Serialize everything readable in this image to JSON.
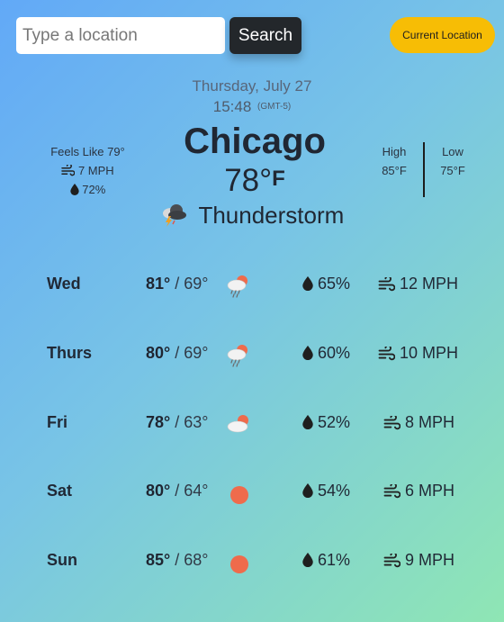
{
  "search": {
    "placeholder": "Type a location",
    "button_label": "Search",
    "current_location_label": "Current Location"
  },
  "current": {
    "date": "Thursday, July 27",
    "time": "15:48",
    "timezone": "(GMT-5)",
    "city": "Chicago",
    "temperature": "78°",
    "unit": "F",
    "feels_like": "Feels Like 79°",
    "wind": "7 MPH",
    "humidity": "72%",
    "high_label": "High",
    "high_value": "85°F",
    "low_label": "Low",
    "low_value": "75°F",
    "condition": "Thunderstorm",
    "condition_icon": "thunderstorm-icon"
  },
  "forecast": [
    {
      "day": "Wed",
      "high": "81°",
      "low": "/ 69°",
      "icon": "rain-sun-cloud-icon",
      "humidity": "65%",
      "wind": "12 MPH"
    },
    {
      "day": "Thurs",
      "high": "80°",
      "low": "/ 69°",
      "icon": "rain-sun-cloud-icon",
      "humidity": "60%",
      "wind": "10 MPH"
    },
    {
      "day": "Fri",
      "high": "78°",
      "low": "/ 63°",
      "icon": "partly-cloudy-icon",
      "humidity": "52%",
      "wind": "8 MPH"
    },
    {
      "day": "Sat",
      "high": "80°",
      "low": "/ 64°",
      "icon": "sun-icon",
      "humidity": "54%",
      "wind": "6 MPH"
    },
    {
      "day": "Sun",
      "high": "85°",
      "low": "/ 68°",
      "icon": "sun-icon",
      "humidity": "61%",
      "wind": "9 MPH"
    }
  ],
  "colors": {
    "background_start": "#62a9f7",
    "background_end": "#8fe6b4",
    "current_location_button": "#f7bd05",
    "search_button": "#23272b",
    "sun": "#ef6b4c"
  }
}
